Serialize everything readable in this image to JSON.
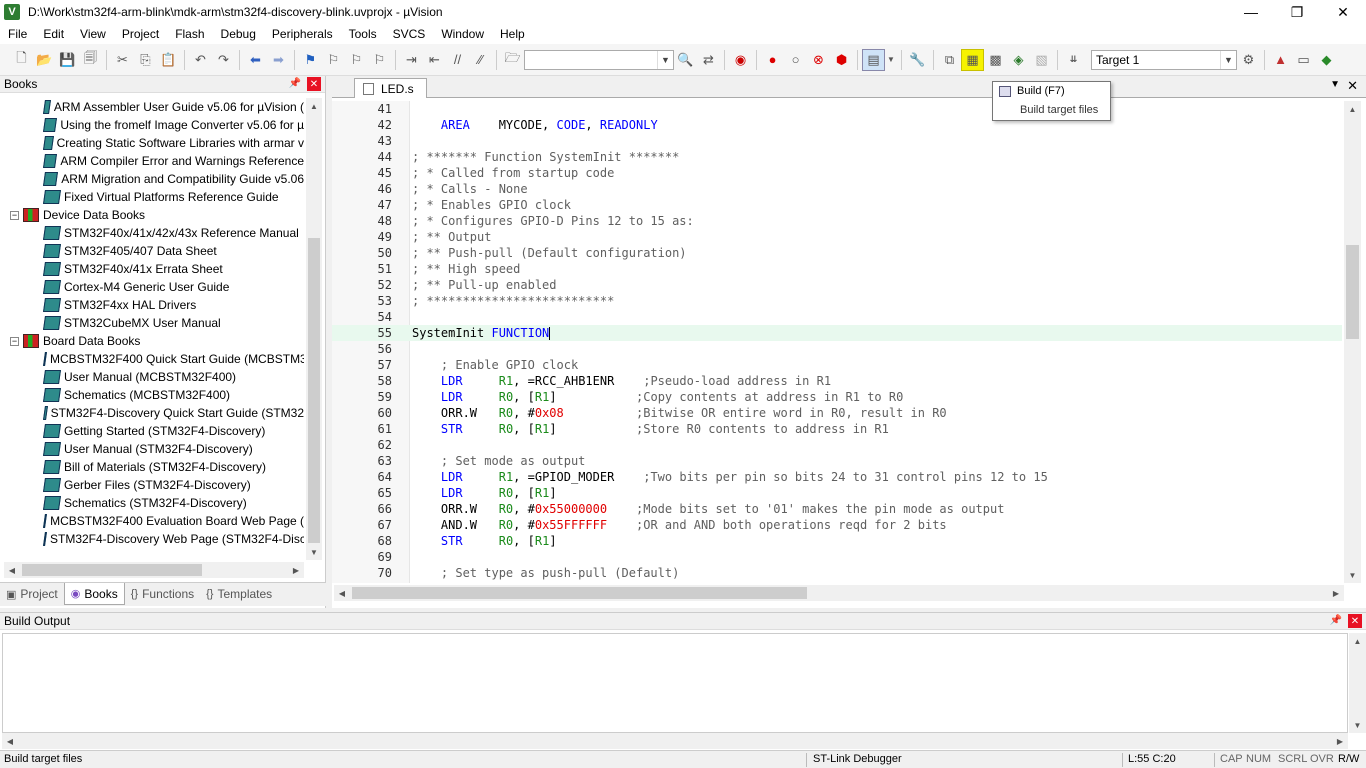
{
  "window": {
    "title": "D:\\Work\\stm32f4-arm-blink\\mdk-arm\\stm32f4-discovery-blink.uvprojx - µVision",
    "app_icon": "V",
    "minimize": "—",
    "maximize": "❐",
    "close": "✕"
  },
  "menu": [
    "File",
    "Edit",
    "View",
    "Project",
    "Flash",
    "Debug",
    "Peripherals",
    "Tools",
    "SVCS",
    "Window",
    "Help"
  ],
  "toolbar": {
    "target": "Target 1",
    "highlighted_button": "build-icon"
  },
  "tooltip": {
    "title": "Build (F7)",
    "description": "Build target files"
  },
  "books_panel": {
    "title": "Books",
    "tree": [
      {
        "type": "child",
        "label": "ARM Assembler User Guide v5.06 for µVision ("
      },
      {
        "type": "child",
        "label": "Using the fromelf Image Converter v5.06 for µ"
      },
      {
        "type": "child",
        "label": "Creating Static Software Libraries with armar v"
      },
      {
        "type": "child",
        "label": "ARM Compiler Error and Warnings Reference"
      },
      {
        "type": "child",
        "label": "ARM Migration and Compatibility Guide v5.06"
      },
      {
        "type": "child",
        "label": "Fixed Virtual Platforms Reference Guide"
      },
      {
        "type": "group",
        "label": "Device Data Books"
      },
      {
        "type": "child",
        "label": "STM32F40x/41x/42x/43x Reference Manual"
      },
      {
        "type": "child",
        "label": "STM32F405/407 Data Sheet"
      },
      {
        "type": "child",
        "label": "STM32F40x/41x Errata Sheet"
      },
      {
        "type": "child",
        "label": "Cortex-M4 Generic User Guide"
      },
      {
        "type": "child",
        "label": "STM32F4xx HAL Drivers"
      },
      {
        "type": "child",
        "label": "STM32CubeMX User Manual"
      },
      {
        "type": "group",
        "label": "Board Data Books"
      },
      {
        "type": "child",
        "label": "MCBSTM32F400 Quick Start Guide (MCBSTM3"
      },
      {
        "type": "child",
        "label": "User Manual (MCBSTM32F400)"
      },
      {
        "type": "child",
        "label": "Schematics (MCBSTM32F400)"
      },
      {
        "type": "child",
        "label": "STM32F4-Discovery Quick Start Guide (STM32"
      },
      {
        "type": "child",
        "label": "Getting Started (STM32F4-Discovery)"
      },
      {
        "type": "child",
        "label": "User Manual (STM32F4-Discovery)"
      },
      {
        "type": "child",
        "label": "Bill of Materials (STM32F4-Discovery)"
      },
      {
        "type": "child",
        "label": "Gerber Files (STM32F4-Discovery)"
      },
      {
        "type": "child",
        "label": "Schematics (STM32F4-Discovery)"
      },
      {
        "type": "child",
        "label": "MCBSTM32F400 Evaluation Board Web Page ("
      },
      {
        "type": "child",
        "label": "STM32F4-Discovery Web Page (STM32F4-Disc"
      }
    ],
    "tabs": [
      {
        "label": "Project",
        "icon": "▣"
      },
      {
        "label": "Books",
        "icon": "◉",
        "active": true
      },
      {
        "label": "Functions",
        "icon": "{}"
      },
      {
        "label": "Templates",
        "icon": "{}"
      }
    ]
  },
  "editor": {
    "tab_label": "LED.s",
    "lines": [
      {
        "n": "41",
        "t": ""
      },
      {
        "n": "42",
        "t": "    <k>AREA</k>    MYCODE, <k>CODE</k>, <k>READONLY</k>"
      },
      {
        "n": "43",
        "t": ""
      },
      {
        "n": "44",
        "t": "<c>; ******* Function SystemInit *******</c>"
      },
      {
        "n": "45",
        "t": "<c>; * Called from startup code</c>"
      },
      {
        "n": "46",
        "t": "<c>; * Calls - None</c>"
      },
      {
        "n": "47",
        "t": "<c>; * Enables GPIO clock</c>"
      },
      {
        "n": "48",
        "t": "<c>; * Configures GPIO-D Pins 12 to 15 as:</c>"
      },
      {
        "n": "49",
        "t": "<c>; ** Output</c>"
      },
      {
        "n": "50",
        "t": "<c>; ** Push-pull (Default configuration)</c>"
      },
      {
        "n": "51",
        "t": "<c>; ** High speed</c>"
      },
      {
        "n": "52",
        "t": "<c>; ** Pull-up enabled</c>"
      },
      {
        "n": "53",
        "t": "<c>; **************************</c>"
      },
      {
        "n": "54",
        "t": ""
      },
      {
        "n": "55",
        "t": "SystemInit <k>FUNCTION</k>",
        "current": true
      },
      {
        "n": "56",
        "t": ""
      },
      {
        "n": "57",
        "t": "    <c>; Enable GPIO clock</c>"
      },
      {
        "n": "58",
        "t": "    <k>LDR</k>     <r>R1</r>, =RCC_AHB1ENR    <c>;Pseudo-load address in R1</c>"
      },
      {
        "n": "59",
        "t": "    <k>LDR</k>     <r>R0</r>, [<r>R1</r>]           <c>;Copy contents at address in R1 to R0</c>"
      },
      {
        "n": "60",
        "t": "    ORR.W   <r>R0</r>, #<m>0x08</m>          <c>;Bitwise OR entire word in R0, result in R0</c>"
      },
      {
        "n": "61",
        "t": "    <k>STR</k>     <r>R0</r>, [<r>R1</r>]           <c>;Store R0 contents to address in R1</c>"
      },
      {
        "n": "62",
        "t": ""
      },
      {
        "n": "63",
        "t": "    <c>; Set mode as output</c>"
      },
      {
        "n": "64",
        "t": "    <k>LDR</k>     <r>R1</r>, =GPIOD_MODER    <c>;Two bits per pin so bits 24 to 31 control pins 12 to 15</c>"
      },
      {
        "n": "65",
        "t": "    <k>LDR</k>     <r>R0</r>, [<r>R1</r>]"
      },
      {
        "n": "66",
        "t": "    ORR.W   <r>R0</r>, #<m>0x55000000</m>    <c>;Mode bits set to '01' makes the pin mode as output</c>"
      },
      {
        "n": "67",
        "t": "    AND.W   <r>R0</r>, #<m>0x55FFFFFF</m>    <c>;OR and AND both operations reqd for 2 bits</c>"
      },
      {
        "n": "68",
        "t": "    <k>STR</k>     <r>R0</r>, [<r>R1</r>]"
      },
      {
        "n": "69",
        "t": ""
      },
      {
        "n": "70",
        "t": "    <c>; Set type as push-pull (Default)</c>"
      }
    ]
  },
  "build_output": {
    "title": "Build Output"
  },
  "status": {
    "message": "Build target files",
    "debugger": "ST-Link Debugger",
    "position": "L:55 C:20",
    "cap": "CAP",
    "num": "NUM",
    "scrl": "SCRL",
    "ovr": "OVR",
    "rw": "R/W"
  },
  "colors": {
    "keyword": "#0000ff",
    "comment": "#5f5f5f",
    "number": "#e00000",
    "register": "#1a8a1a",
    "current_line": "#e8f9ee",
    "highlight": "#f6f200"
  }
}
